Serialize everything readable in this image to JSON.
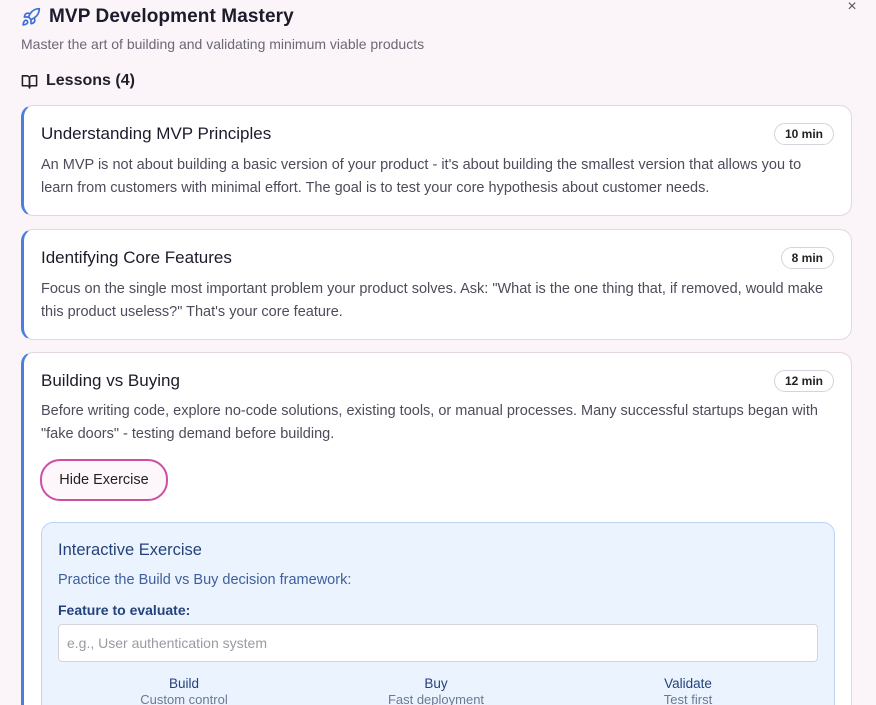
{
  "header": {
    "title": "MVP Development Mastery",
    "subtitle": "Master the art of building and validating minimum viable products",
    "close_symbol": "×"
  },
  "lessons": {
    "heading": "Lessons (4)",
    "items": [
      {
        "title": "Understanding MVP Principles",
        "duration": "10 min",
        "text": "An MVP is not about building a basic version of your product - it's about building the smallest version that allows you to learn from customers with minimal effort. The goal is to test your core hypothesis about customer needs."
      },
      {
        "title": "Identifying Core Features",
        "duration": "8 min",
        "text": "Focus on the single most important problem your product solves. Ask: \"What is the one thing that, if removed, would make this product useless?\" That's your core feature."
      },
      {
        "title": "Building vs Buying",
        "duration": "12 min",
        "text": "Before writing code, explore no-code solutions, existing tools, or manual processes. Many successful startups began with \"fake doors\" - testing demand before building.",
        "hide_exercise_label": "Hide Exercise"
      }
    ]
  },
  "exercise": {
    "title": "Interactive Exercise",
    "description": "Practice the Build vs Buy decision framework:",
    "feature_label": "Feature to evaluate:",
    "feature_placeholder": "e.g., User authentication system",
    "feature_value": "",
    "options": [
      {
        "name": "Build",
        "sub": "Custom control"
      },
      {
        "name": "Buy",
        "sub": "Fast deployment"
      },
      {
        "name": "Validate",
        "sub": "Test first"
      }
    ]
  },
  "colors": {
    "accent_border": "#4a7fe0",
    "button_border": "#cc4fa5",
    "exercise_bg": "#ebf3fe"
  }
}
